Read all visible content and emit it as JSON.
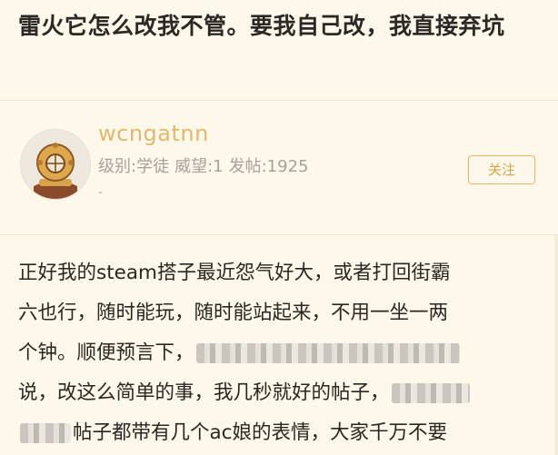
{
  "thread": {
    "title": "雷火它怎么改我不管。要我自己改，我直接弃坑"
  },
  "user": {
    "name": "wcngatnn",
    "level_label": "级别:学徒",
    "prestige_label": "威望:1",
    "posts_label": "发帖:1925",
    "extra": "-",
    "follow_label": "关注",
    "avatar_icon": "diving-helmet-avatar"
  },
  "post": {
    "line1": "正好我的steam搭子最近怨气好大，或者打回街霸",
    "line2": "六也行，随时能玩，随时能站起来，不用一坐一两",
    "line3_before": "个钟。顺便预言下，",
    "line4_before": "说，改这么简单的事，我几秒就好的帖子，",
    "line5_after": "帖子都带有几个ac娘的表情，大家千万不要"
  },
  "colors": {
    "background": "#fdf8ea",
    "username": "#e0b96e",
    "follow_accent": "#e3b767"
  }
}
